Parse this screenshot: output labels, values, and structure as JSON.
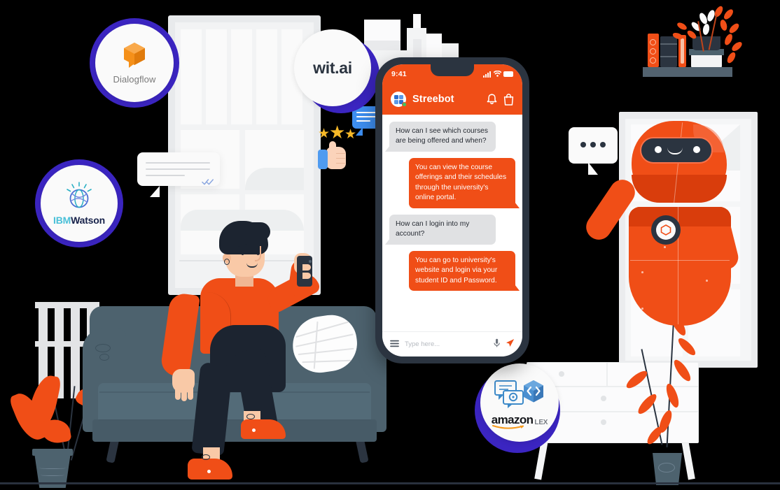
{
  "scene": {
    "title": "Chatbot platforms illustration",
    "background_color": "#000000",
    "accent_orange": "#f04e17",
    "accent_purple": "#3b25c1",
    "couch_color": "#4d626e",
    "dark_navy": "#2b3440"
  },
  "phone": {
    "status": {
      "time": "9:41",
      "signal_icon": "signal-bars-icon",
      "wifi_icon": "wifi-icon",
      "battery_icon": "battery-icon"
    },
    "header": {
      "avatar_icon": "streebot-avatar-icon",
      "online_dot": "online-status-dot",
      "title": "Streebot",
      "bell_icon": "bell-icon",
      "bag_icon": "shopping-bag-icon"
    },
    "messages": [
      {
        "from": "bot",
        "text": "How can I see which courses are being offered and when?"
      },
      {
        "from": "user",
        "text": "You can view the course offerings and their schedules through the university's online portal."
      },
      {
        "from": "bot",
        "text": "How can I login into my account?"
      },
      {
        "from": "user",
        "text": "You can go to university's website and login via your student ID and Password."
      }
    ],
    "input": {
      "menu_icon": "hamburger-menu-icon",
      "placeholder": "Type here...",
      "value": "",
      "mic_icon": "microphone-icon",
      "send_icon": "send-icon"
    }
  },
  "badges": [
    {
      "id": "dialogflow",
      "label": "Dialogflow",
      "icon": "dialogflow-cube-icon",
      "ring_color": "#3b25c1"
    },
    {
      "id": "witai",
      "label": "wit.ai",
      "icon": "witai-wordmark-icon",
      "ring_color": "#3b25c1"
    },
    {
      "id": "ibmwatson",
      "label_a": "IBM",
      "label_b": "Watson",
      "icon": "ibm-watson-globe-icon",
      "ring_color": "#3b25c1"
    },
    {
      "id": "amazonlex",
      "label_a": "amazon",
      "label_b": "LEX",
      "icon": "amazon-lex-icon",
      "ring_color": "#3b25c1"
    }
  ],
  "floating": {
    "chat_bubble_lines": 3,
    "read_receipt_icon": "double-check-icon",
    "rating_stars": 3,
    "thumbs_up_icon": "thumbs-up-icon",
    "robot_bubble_dots": 3
  },
  "robot": {
    "name": "robot-character",
    "body_color": "#f04e17",
    "visor_color": "#2b3440",
    "chest_badge_icon": "hexagon-badge-icon"
  },
  "person": {
    "name": "person-on-couch",
    "sweater_color": "#f04e17",
    "pants_color": "#1c2430",
    "holding_icon": "smartphone-icon"
  },
  "room": {
    "window_left": "window-panes",
    "window_right": "window-panes",
    "radiator": "radiator",
    "dresser": "dresser-three-drawers",
    "shelf_books": 3,
    "plants": 3,
    "skyline": "city-skyline"
  }
}
